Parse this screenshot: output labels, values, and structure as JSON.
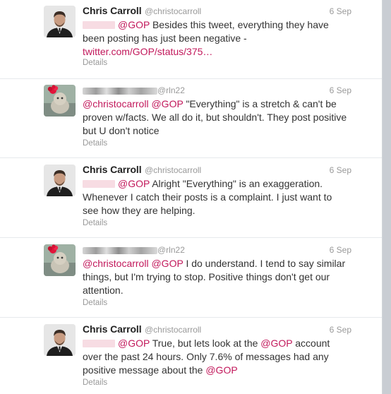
{
  "tweets": [
    {
      "name": "Chris Carroll",
      "handle": "@christocarroll",
      "time": "6 Sep",
      "mentions": [
        "@GOP"
      ],
      "body": "Besides this tweet, everything they have been posting has just been negative -",
      "link": "twitter.com/GOP/status/375…",
      "details": "Details"
    },
    {
      "handle": "@rln22",
      "time": "6 Sep",
      "mentions": [
        "@christocarroll",
        "@GOP"
      ],
      "body": "\"Everything\" is a stretch & can't be proven w/facts. We all do it, but shouldn't. They post positive but U don't notice",
      "details": "Details"
    },
    {
      "name": "Chris Carroll",
      "handle": "@christocarroll",
      "time": "6 Sep",
      "mentions": [
        "@GOP"
      ],
      "body": "Alright \"Everything\" is an exaggeration. Whenever I catch their posts is a complaint.  I just want to see how they are helping.",
      "details": "Details"
    },
    {
      "handle": "@rln22",
      "time": "6 Sep",
      "mentions": [
        "@christocarroll",
        "@GOP"
      ],
      "body": "I do understand. I tend to say similar things, but I'm trying to stop. Positive things don't get our attention.",
      "details": "Details"
    },
    {
      "name": "Chris Carroll",
      "handle": "@christocarroll",
      "time": "6 Sep",
      "mentions": [
        "@GOP"
      ],
      "body_a": "True, but lets look at the",
      "inline_mention_a": "@GOP",
      "body_b": "account over the past 24 hours.  Only 7.6% of messages had any positive message about the",
      "inline_mention_b": "@GOP",
      "details": "Details"
    }
  ],
  "colors": {
    "link": "#c2185b",
    "meta": "#999999",
    "text": "#333333",
    "name": "#222222",
    "page_side": "#c9cdd3"
  }
}
